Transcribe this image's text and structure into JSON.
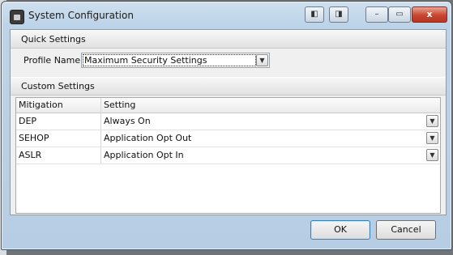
{
  "window": {
    "title": "System Configuration"
  },
  "titlebar": {
    "close_glyph": "x",
    "minimize_glyph": "–",
    "maximize_glyph": "▭"
  },
  "quick_settings": {
    "header": "Quick Settings",
    "profile_label": "Profile Name",
    "profile_value": "Maximum Security Settings"
  },
  "custom_settings": {
    "header": "Custom Settings",
    "columns": [
      "Mitigation",
      "Setting"
    ],
    "rows": [
      {
        "mitigation": "DEP",
        "setting": "Always On"
      },
      {
        "mitigation": "SEHOP",
        "setting": "Application Opt Out"
      },
      {
        "mitigation": "ASLR",
        "setting": "Application Opt In"
      }
    ]
  },
  "buttons": {
    "ok": "OK",
    "cancel": "Cancel"
  },
  "colors": {
    "close_button": "#c9452f",
    "titlebar": "#bcd3e8",
    "client": "#f0f0f0"
  }
}
